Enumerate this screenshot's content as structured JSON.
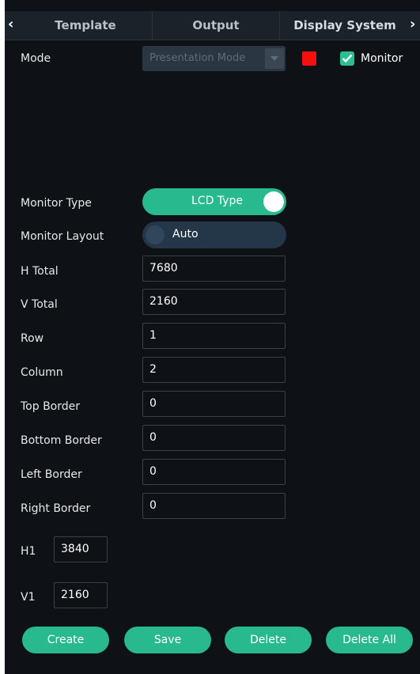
{
  "tabs": [
    {
      "label": "Template"
    },
    {
      "label": "Output"
    },
    {
      "label": "Display System"
    }
  ],
  "mode": {
    "label": "Mode",
    "value": "Presentation Mode",
    "color": "#f50f0f",
    "monitor_label": "Monitor",
    "monitor_checked": true
  },
  "monitor_type": {
    "label": "Monitor Type",
    "value": "LCD Type",
    "on": true
  },
  "monitor_layout": {
    "label": "Monitor Layout",
    "value": "Auto",
    "on": false
  },
  "fields": [
    {
      "label": "H Total",
      "value": "7680"
    },
    {
      "label": "V Total",
      "value": "2160"
    },
    {
      "label": "Row",
      "value": "1"
    },
    {
      "label": "Column",
      "value": "2"
    },
    {
      "label": "Top Border",
      "value": "0"
    },
    {
      "label": "Bottom Border",
      "value": "0"
    },
    {
      "label": "Left Border",
      "value": "0"
    },
    {
      "label": "Right Border",
      "value": "0"
    }
  ],
  "small_fields": [
    {
      "label": "H1",
      "value": "3840"
    },
    {
      "label": "V1",
      "value": "2160"
    }
  ],
  "buttons": {
    "create": "Create",
    "save": "Save",
    "delete": "Delete",
    "delete_all": "Delete All"
  },
  "colors": {
    "accent": "#29b98f",
    "background": "#0e1216",
    "tabbar": "#1b222a"
  },
  "icons": {
    "tab_prev": "chevron-left-icon",
    "tab_next": "chevron-right-icon",
    "dropdown": "triangle-down-icon",
    "check": "checkmark-icon"
  }
}
